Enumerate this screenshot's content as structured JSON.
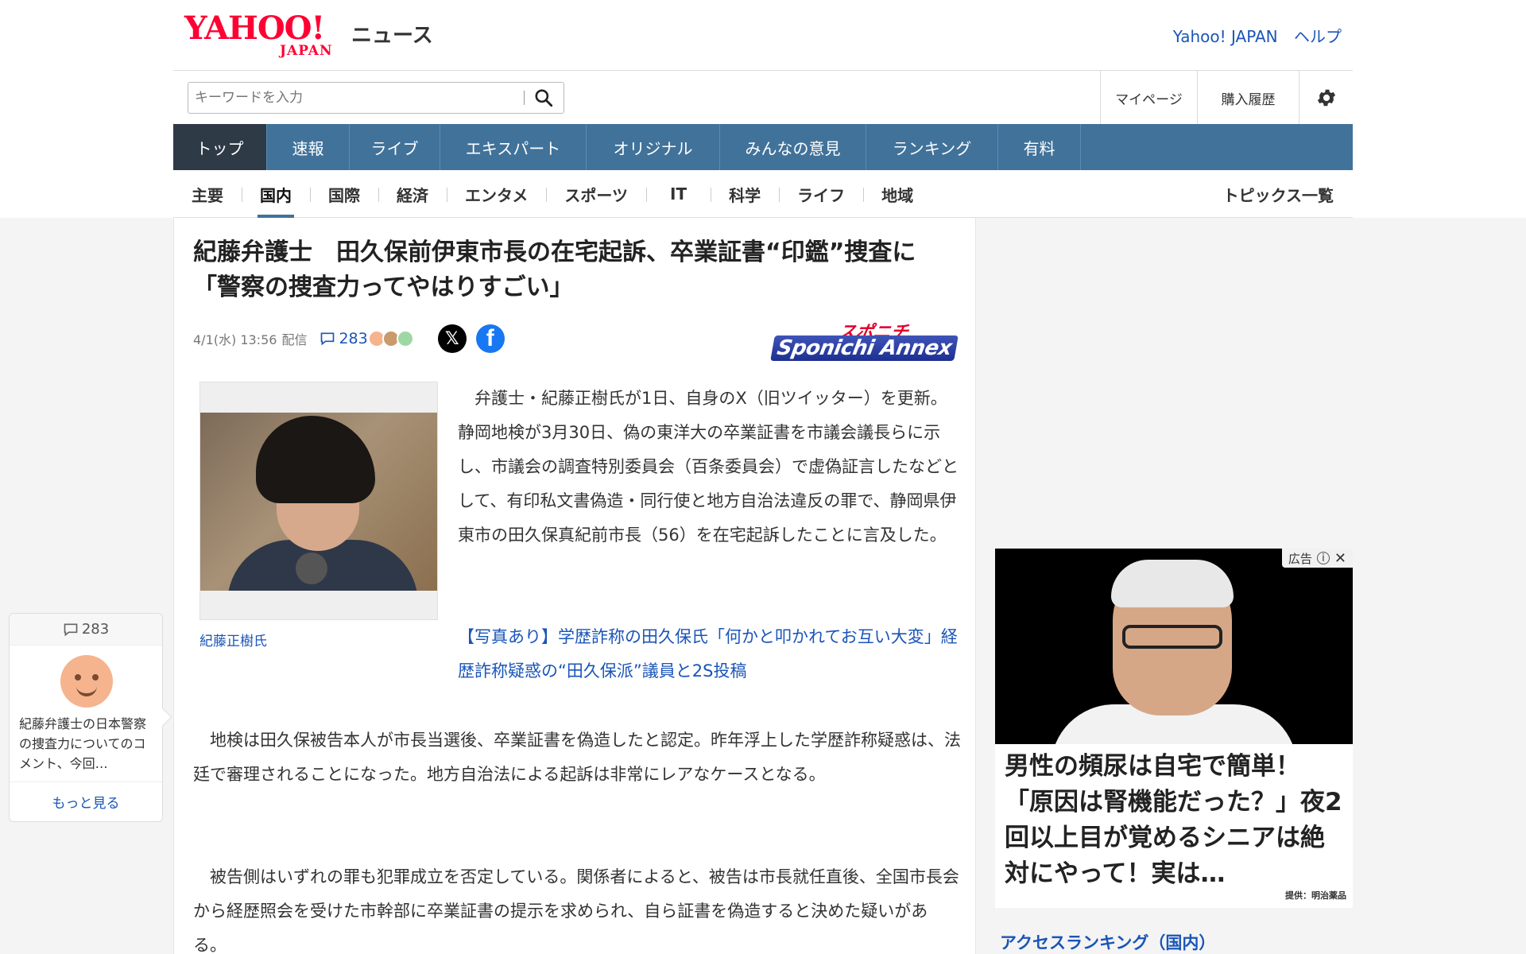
{
  "header": {
    "logo_yahoo": "YAHOO!",
    "logo_japan": "JAPAN",
    "logo_news": "ニュース",
    "links": [
      "Yahoo! JAPAN",
      "ヘルプ"
    ]
  },
  "search": {
    "placeholder": "キーワードを入力",
    "icon": "search-icon"
  },
  "account_links": {
    "mypage": "マイページ",
    "history": "購入履歴",
    "settings_icon": "gear-icon"
  },
  "main_nav": [
    {
      "label": "トップ",
      "active": true
    },
    {
      "label": "速報"
    },
    {
      "label": "ライブ"
    },
    {
      "label": "エキスパート"
    },
    {
      "label": "オリジナル"
    },
    {
      "label": "みんなの意見"
    },
    {
      "label": "ランキング"
    },
    {
      "label": "有料"
    }
  ],
  "sub_nav": {
    "items": [
      "主要",
      "国内",
      "国際",
      "経済",
      "エンタメ",
      "スポーツ",
      "IT",
      "科学",
      "ライフ",
      "地域"
    ],
    "active": "国内",
    "topics_link": "トピックス一覧"
  },
  "article": {
    "headline_line1": "紀藤弁護士　田久保前伊東市長の在宅起訴、卒業証書“印鑑”捜査に",
    "headline_line2": "「警察の捜査力ってやはりすごい」",
    "date": "4/1(水) 13:56",
    "distribution": "配信",
    "comment_count": "283",
    "publisher_top": "スポニチ",
    "publisher_bottom": "Sponichi Annex",
    "photo_caption": "紀藤正樹氏",
    "paragraph1": "弁護士・紀藤正樹氏が1日、自身のX（旧ツイッター）を更新。静岡地検が3月30日、偽の東洋大の卒業証書を市議会議長らに示し、市議会の調査特別委員会（百条委員会）で虚偽証言したなどとして、有印私文書偽造・同行使と地方自治法違反の罪で、静岡県伊東市の田久保真紀前市長（56）を在宅起訴したことに言及した。",
    "related_link": "【写真あり】学歴詐称の田久保氏「何かと叩かれてお互い大変」経歴詐称疑惑の“田久保派”議員と2S投稿",
    "paragraph2": "地検は田久保被告本人が市長当選後、卒業証書を偽造したと認定。昨年浮上した学歴詐称疑惑は、法廷で審理されることになった。地方自治法による起訴は非常にレアなケースとなる。",
    "paragraph3": "被告側はいずれの罪も犯罪成立を否定している。関係者によると、被告は市長就任直後、全国市長会から経歴照会を受けた市幹部に卒業証書の提示を求められ、自ら証書を偽造すると決めた疑いがある。"
  },
  "floating_comment": {
    "count": "283",
    "text": "紀藤弁護士の日本警察の捜査力についてのコメント、今回…",
    "more": "もっと見る"
  },
  "ad": {
    "label": "広告",
    "text": "男性の頻尿は自宅で簡単！「原因は腎機能だった？」夜2回以上目が覚めるシニアは絶対にやって！実は…",
    "provider": "提供：明治薬品"
  },
  "sidebar": {
    "ranking_title": "アクセスランキング（国内）"
  },
  "colors": {
    "nav_bg": "#41729a",
    "nav_active": "#2f3a47",
    "link": "#1a55b8",
    "brand_red": "#ff0033"
  }
}
